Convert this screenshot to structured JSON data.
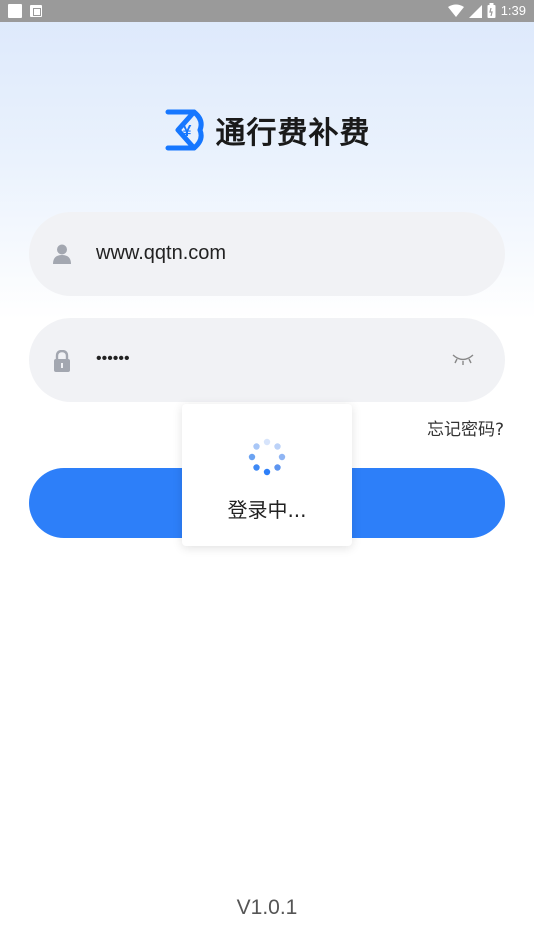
{
  "status_bar": {
    "time": "1:39",
    "icons": [
      "square-icon",
      "notification-a-icon",
      "wifi-icon",
      "signal-icon",
      "battery-icon"
    ]
  },
  "app": {
    "title": "通行费补费",
    "logo_icon": "yen-logo-icon",
    "brand_color": "#1677ff"
  },
  "form": {
    "username": {
      "value": "www.qqtn.com",
      "icon": "user-icon"
    },
    "password": {
      "value": "••••••",
      "icon": "lock-icon",
      "toggle_icon": "eye-closed-icon"
    },
    "forgot_label": "忘记密码?",
    "login_button_color": "#2d7ff9"
  },
  "loading": {
    "text": "登录中...",
    "icon": "spinner-icon"
  },
  "footer": {
    "version": "V1.0.1"
  }
}
